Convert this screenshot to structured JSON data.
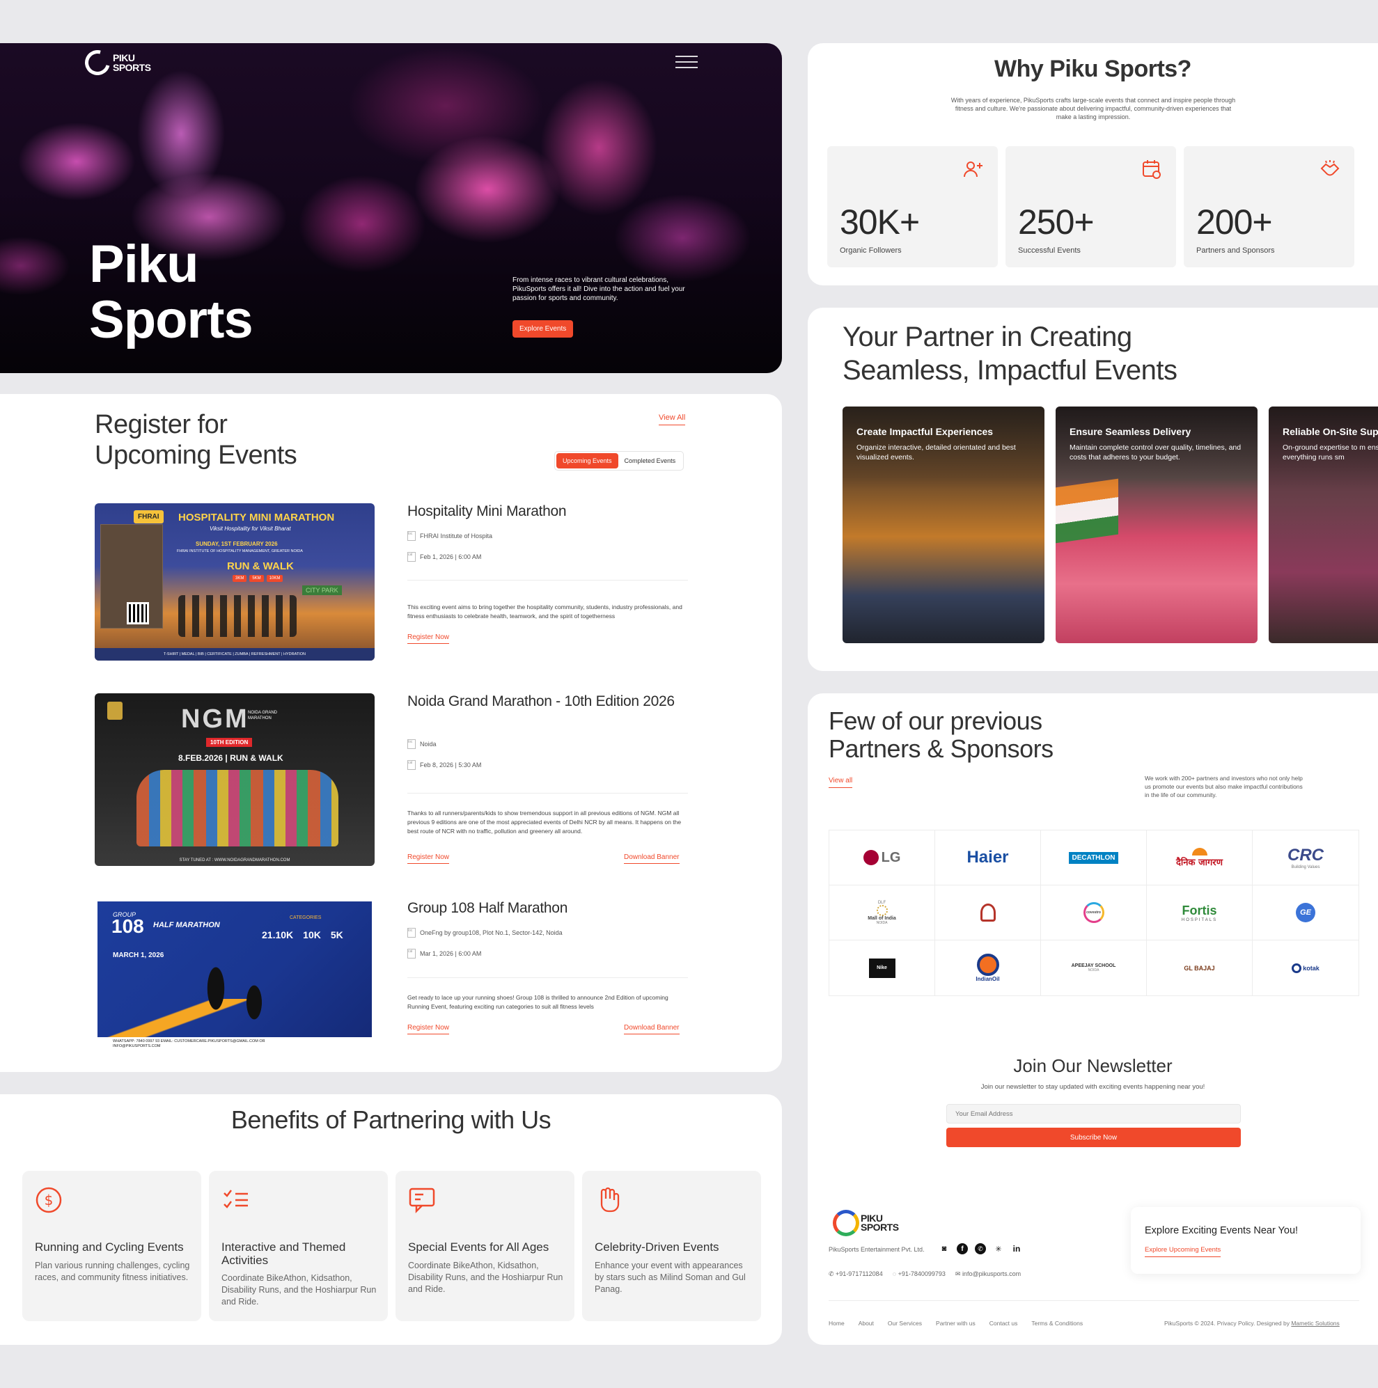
{
  "hero": {
    "logo_text": "PIKU\nSPORTS",
    "title_line1": "Piku",
    "title_line2": "Sports",
    "description": "From intense races to vibrant cultural celebrations, PikuSports offers it all! Dive into the action and fuel your passion for sports and community.",
    "cta": "Explore Events"
  },
  "events": {
    "heading_line1": "Register for",
    "heading_line2": "Upcoming Events",
    "view_all": "View All",
    "tabs": [
      "Upcoming Events",
      "Completed Events"
    ],
    "items": [
      {
        "title": "Hospitality Mini Marathon",
        "location": "FHRAI Institute of Hospita",
        "date": "Feb 1, 2026 | 6:00 AM",
        "description": "This exciting event aims to bring together the hospitality community, students, industry professionals, and fitness enthusiasts to celebrate health, teamwork, and the spirit of togetherness",
        "register": "Register Now",
        "download": "",
        "poster": {
          "badge": "FHRAI",
          "title": "HOSPITALITY MINI MARATHON",
          "subtitle": "Viksit Hospitality for Viksit Bharat",
          "date": "SUNDAY, 1ST FEBRUARY 2026",
          "venue": "FHRAI INSTITUTE OF HOSPITALITY MANAGEMENT, GREATER NOIDA",
          "run": "RUN & WALK",
          "distances": [
            "3KM",
            "5KM",
            "10KM"
          ],
          "sign": "CITY PARK",
          "footer": "T-SHIRT | MEDAL | BIB | CERTIFICATE | ZUMBA | REFRESHMENT | HYDRATION"
        }
      },
      {
        "title": "Noida Grand Marathon - 10th Edition 2026",
        "location": "Noida",
        "date": "Feb 8, 2026 | 5:30 AM",
        "description": "Thanks to all runners/parents/kids to show tremendous support in all previous editions of NGM. NGM all previous 9 editions are one of the most appreciated events of Delhi NCR by all means. It happens on the best route of NCR with no traffic, pollution and greenery all around.",
        "register": "Register Now",
        "download": "Download Banner",
        "poster": {
          "title": "NGM",
          "small": "NOIDA GRAND MARATHON",
          "edition": "10TH EDITION",
          "date": "8.FEB.2026 | RUN & WALK",
          "footer": "STAY TUNED AT : WWW.NOIDAGRANDMARATHON.COM"
        }
      },
      {
        "title": "Group 108 Half Marathon",
        "location": "OneFng by group108, Plot No.1, Sector-142, Noida",
        "date": "Mar 1, 2026 | 6:00 AM",
        "description": "Get ready to lace up your running shoes! Group 108 is thrilled to announce 2nd Edition of upcoming Running Event, featuring exciting run categories to suit all fitness levels",
        "register": "Register Now",
        "download": "Download Banner",
        "poster": {
          "title": "108",
          "small": "GROUP",
          "script": "HALF MARATHON",
          "date": "MARCH 1, 2026",
          "categories_label": "CATEGORIES",
          "categories": [
            "21.10K",
            "10K",
            "5K"
          ],
          "footer": "WHATSAPP: 7840 0997 93  EMAIL: CUSTOMERCARE.PIKUSPORTS@GMAIL.COM OR INFO@PIKUSPORTS.COM"
        }
      }
    ]
  },
  "benefits": {
    "heading": "Benefits of Partnering with Us",
    "items": [
      {
        "icon": "dollar-circle-icon",
        "title": "Running and Cycling Events",
        "description": "Plan various running challenges, cycling races, and community fitness initiatives."
      },
      {
        "icon": "checklist-icon",
        "title": "Interactive and Themed Activities",
        "description": "Coordinate BikeAthon, Kidsathon, Disability Runs, and the Hoshiarpur Run and Ride."
      },
      {
        "icon": "chat-icon",
        "title": "Special Events for All Ages",
        "description": "Coordinate BikeAthon, Kidsathon, Disability Runs, and the Hoshiarpur Run and Ride."
      },
      {
        "icon": "hand-icon",
        "title": "Celebrity-Driven Events",
        "description": "Enhance your event with appearances by stars such as Milind Soman and Gul Panag."
      }
    ]
  },
  "why": {
    "heading": "Why Piku Sports?",
    "subtitle": "With years of experience, PikuSports crafts large-scale events that connect and inspire people through fitness and culture. We're passionate about delivering impactful, community-driven experiences that make a lasting impression.",
    "stats": [
      {
        "icon": "users-plus-icon",
        "value": "30K+",
        "label": "Organic Followers"
      },
      {
        "icon": "calendar-icon",
        "value": "250+",
        "label": "Successful Events"
      },
      {
        "icon": "handshake-icon",
        "value": "200+",
        "label": "Partners and Sponsors"
      }
    ]
  },
  "partner": {
    "heading_line1": "Your Partner in Creating",
    "heading_line2": "Seamless, Impactful Events",
    "cards": [
      {
        "title": "Create Impactful Experiences",
        "description": "Organize interactive, detailed orientated and best visualized events."
      },
      {
        "title": "Ensure Seamless Delivery",
        "description": "Maintain complete control over quality, timelines, and costs that adheres to your budget."
      },
      {
        "title": "Reliable On-Site Sup",
        "description": "On-ground expertise to m ensure everything runs sm"
      }
    ]
  },
  "sponsors": {
    "heading_line1": "Few of our previous",
    "heading_line2": "Partners & Sponsors",
    "view_all": "View all",
    "note": "We work with 200+ partners and investors who not only help us promote our events but also make impactful contributions in the life of our community.",
    "logos": [
      "LG",
      "Haier",
      "DECATHLON",
      "दैनिक जागरण",
      "CRC",
      "Mall of India",
      "Emblem",
      "covestro",
      "Fortis",
      "GE",
      "Nike",
      "IndianOil",
      "APEEJAY SCHOOL",
      "GL BAJAJ",
      "kotak"
    ],
    "crc_sub": "Building Values",
    "mall_sub": "DLF",
    "mall_sub2": "NOIDA",
    "fortis_sub": "HOSPITALS",
    "apeejay_sub": "NOIDA"
  },
  "newsletter": {
    "title": "Join Our Newsletter",
    "subtitle": "Join our newsletter to stay updated with exciting events happening near you!",
    "placeholder": "Your Email Address",
    "button": "Subscribe Now"
  },
  "footer": {
    "logo_text": "PIKU\nSPORTS",
    "company": "PikuSports Entertainment Pvt. Ltd.",
    "phone1": "+91-9717112084",
    "phone2": "+91-7840099793",
    "email": "info@pikusports.com",
    "explore_title": "Explore Exciting Events Near You!",
    "explore_link": "Explore Upcoming Events",
    "nav": [
      "Home",
      "About",
      "Our Services",
      "Partner with us",
      "Contact us",
      "Terms & Conditions"
    ],
    "copyright": "PikuSports © 2024. Privacy Policy. Designed by",
    "designer": "Mametic Solutions"
  },
  "colors": {
    "accent": "#f0492b",
    "text": "#2a2a2a",
    "card": "#f3f3f3",
    "background": "#e9e9ec"
  }
}
